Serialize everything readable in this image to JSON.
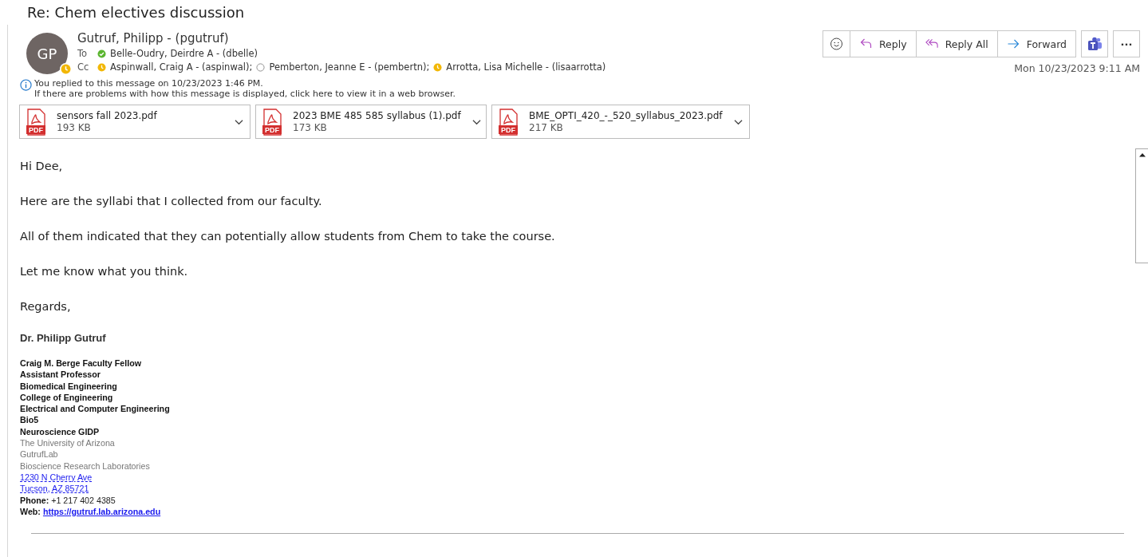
{
  "subject": "Re: Chem electives discussion",
  "sender": {
    "initials": "GP",
    "name": "Gutruf, Philipp - (pgutruf)",
    "kind": "away"
  },
  "to": {
    "label": "To",
    "recipients": [
      {
        "name": "Belle-Oudry, Deirdre A - (dbelle)",
        "kind": "available"
      }
    ]
  },
  "cc": {
    "label": "Cc",
    "recipients": [
      {
        "name": "Aspinwall, Craig A - (aspinwal);",
        "kind": "away"
      },
      {
        "name": "Pemberton, Jeanne E - (pembertn);",
        "kind": "offline"
      },
      {
        "name": "Arrotta, Lisa Michelle - (lisaarrotta)",
        "kind": "away"
      }
    ]
  },
  "info": {
    "lines": [
      "You replied to this message on 10/23/2023 1:46 PM.",
      "If there are problems with how this message is displayed, click here to view it in a web browser."
    ]
  },
  "actions": [
    {
      "kind": "emoji"
    },
    {
      "kind": "reply",
      "label": "Reply"
    },
    {
      "kind": "reply_all",
      "label": "Reply All"
    },
    {
      "kind": "forward",
      "label": "Forward"
    }
  ],
  "extra_buttons": [
    {
      "kind": "teams"
    },
    {
      "kind": "more",
      "label": "···"
    }
  ],
  "date": "Mon 10/23/2023 9:11 AM",
  "attachments": [
    {
      "name": "sensors fall 2023.pdf",
      "size": "193 KB",
      "type": "PDF"
    },
    {
      "name": "2023 BME 485 585 syllabus (1).pdf",
      "size": "173 KB",
      "type": "PDF"
    },
    {
      "name": "BME_OPTI_420_-_520_syllabus_2023.pdf",
      "size": "217 KB",
      "type": "PDF"
    }
  ],
  "body": [
    "Hi Dee,",
    "Here are the syllabi that I collected from our faculty.",
    "All of them indicated that they can potentially allow students from Chem to take the course.",
    "Let me know what you think.",
    "Regards,"
  ],
  "signature": {
    "name": "Dr. Philipp Gutruf",
    "lines": [
      {
        "kind": "bold",
        "text": "Craig M. Berge Faculty Fellow"
      },
      {
        "kind": "bold",
        "text": "Assistant Professor"
      },
      {
        "kind": "bold",
        "text": "Biomedical Engineering"
      },
      {
        "kind": "bold",
        "text": "College of Engineering"
      },
      {
        "kind": "bold",
        "text": "Electrical and Computer Engineering"
      },
      {
        "kind": "bold",
        "text": "Bio5"
      },
      {
        "kind": "bold",
        "text": "Neuroscience GIDP"
      },
      {
        "kind": "gray",
        "text": "The University of Arizona"
      },
      {
        "kind": "gray",
        "text": "GutrufLab"
      },
      {
        "kind": "gray",
        "text": "Bioscience Research Laboratories"
      },
      {
        "kind": "address",
        "text": "1230 N Cherry Ave"
      },
      {
        "kind": "address",
        "text": "Tucson, AZ 85721"
      },
      {
        "kind": "field",
        "label": "Phone:",
        "text": "+1 217 402 4385"
      },
      {
        "kind": "link_field",
        "label": "Web:",
        "text": "https://gutruf.lab.arizona.edu"
      }
    ]
  }
}
